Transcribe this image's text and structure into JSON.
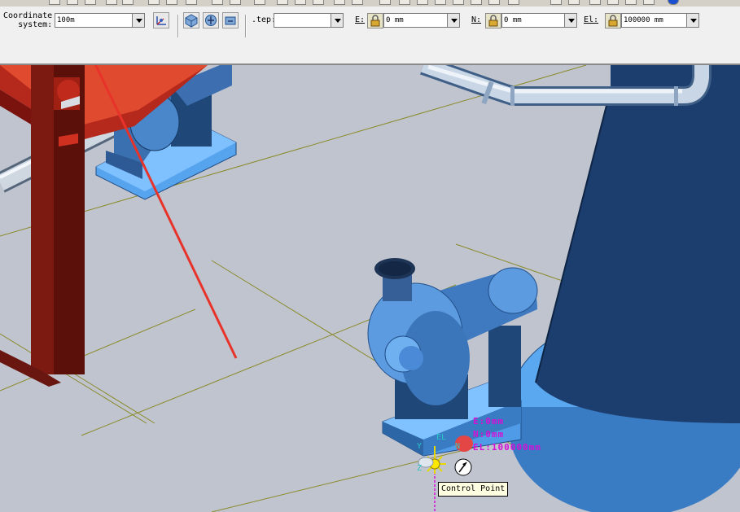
{
  "toolbar": {
    "coordinate_system_label": "Coordinate\nsystem:",
    "coordinate_system_value": "100m",
    "step_label": ".tep:",
    "step_value": "",
    "e_label": "E:",
    "e_value": "0 mm",
    "n_label": "N:",
    "n_value": "0 mm",
    "el_label": "El:",
    "el_value": "100000 mm"
  },
  "viewport": {
    "coord_e": "E:0mm",
    "coord_n": "N:0mm",
    "coord_el": "EL:100000mm",
    "tooltip": "Control Point",
    "axis_y": "Y",
    "axis_el": "EL",
    "axis_n": "N",
    "axis_z": "Z"
  },
  "icons": [
    "view-iso-icon",
    "view-top-icon",
    "view-front-icon",
    "coordinate-system-icon",
    "lock-icon",
    "help-icon"
  ],
  "colors": {
    "background": "#bfc4cf",
    "equipment": "#5a92d6",
    "structure": "#8a1a12",
    "grid": "#8b8b2a",
    "annotation_arrow": "#e8332a",
    "control_point_text": "#d60fd6"
  }
}
